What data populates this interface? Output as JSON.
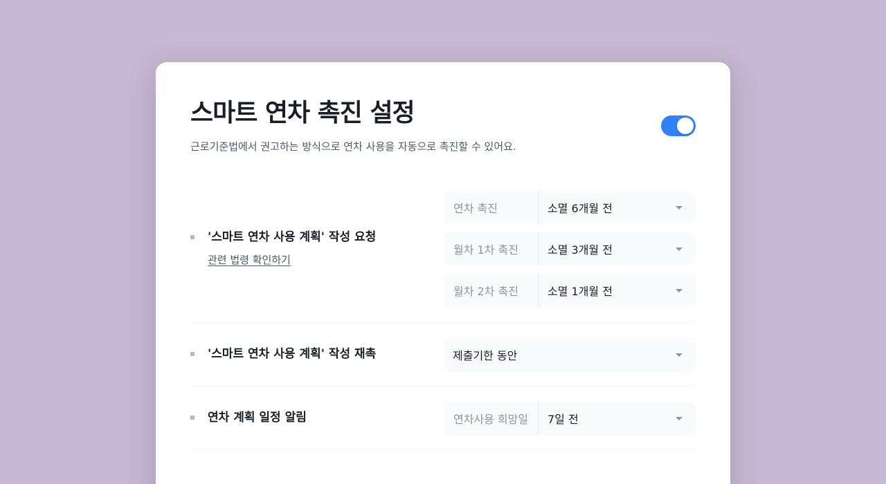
{
  "header": {
    "title": "스마트 연차 촉진 설정",
    "subtitle": "근로기준법에서 권고하는 방식으로 연차 사용을 자동으로 촉진할 수 있어요.",
    "toggle_on": true
  },
  "sections": {
    "request": {
      "label": "'스마트 연차 사용 계획' 작성 요청",
      "link": "관련 법령 확인하기",
      "selects": [
        {
          "label": "연차 촉진",
          "value": "소멸 6개월 전"
        },
        {
          "label": "월차 1차 촉진",
          "value": "소멸 3개월 전"
        },
        {
          "label": "월차 2차 촉진",
          "value": "소멸 1개월 전"
        }
      ]
    },
    "remind": {
      "label": "'스마트 연차 사용 계획' 작성 재촉",
      "select_value": "제출기한 동안"
    },
    "notify": {
      "label": "연차 계획 일정 알림",
      "select_label": "연차사용 희망일",
      "select_value": "7일 전"
    }
  },
  "colors": {
    "background": "#c6b7d2",
    "accent": "#3182f6"
  }
}
